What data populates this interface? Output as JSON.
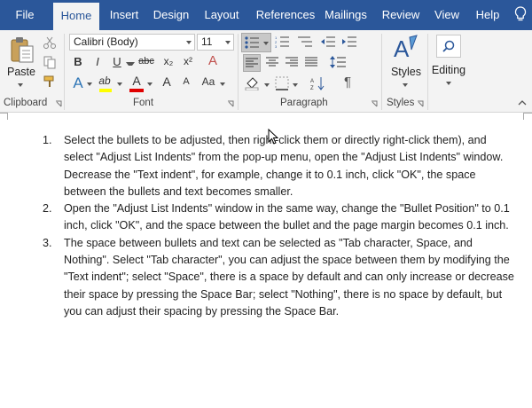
{
  "tabs": [
    {
      "label": "File",
      "active": false
    },
    {
      "label": "Home",
      "active": true
    },
    {
      "label": "Insert",
      "active": false
    },
    {
      "label": "Design",
      "active": false
    },
    {
      "label": "Layout",
      "active": false
    },
    {
      "label": "References",
      "active": false
    },
    {
      "label": "Mailings",
      "active": false
    },
    {
      "label": "Review",
      "active": false
    },
    {
      "label": "View",
      "active": false
    },
    {
      "label": "Help",
      "active": false
    }
  ],
  "ribbon": {
    "clipboard": {
      "paste_label": "Paste",
      "group_label": "Clipboard"
    },
    "font": {
      "font_name": "Calibri (Body)",
      "font_size": "11",
      "group_label": "Font",
      "bold": "B",
      "italic": "I",
      "underline": "U",
      "strike": "abc",
      "subscript": "x₂",
      "superscript": "x²",
      "clear": "A",
      "text_effects": "A",
      "highlight": "ab",
      "font_color": "A",
      "grow": "A",
      "shrink": "A",
      "case": "Aa"
    },
    "paragraph": {
      "group_label": "Paragraph",
      "show_marks": "¶"
    },
    "styles": {
      "label": "Styles",
      "group_label": "Styles"
    },
    "editing": {
      "label": "Editing"
    }
  },
  "colors": {
    "brand": "#2b579a",
    "highlight": "#ffff00",
    "font_color": "#e00000",
    "text_effect": "#2e75b6"
  },
  "document": {
    "items": [
      {
        "num": "1.",
        "text": "Select the bullets to be adjusted, then right-click them or directly right-click them), and select \"Adjust List Indents\" from the pop-up menu, open the \"Adjust List Indents\" window. Decrease the \"Text indent\", for example, change it to 0.1 inch, click \"OK\", the space between the bullets and text becomes smaller."
      },
      {
        "num": "2.",
        "text": "Open the \"Adjust List Indents\" window in the same way, change the \"Bullet Position\" to 0.1 inch, click \"OK\", and the space between the bullet and the page margin becomes 0.1 inch."
      },
      {
        "num": "3.",
        "text": "The space between bullets and text can be selected as \"Tab character, Space, and Nothing\". Select \"Tab character\", you can adjust the space between them by modifying the \"Text indent\"; select \"Space\", there is a space by default and can only increase or decrease their space by pressing the Space Bar; select \"Nothing\", there is no space by default, but you can adjust their spacing by pressing the Space Bar."
      }
    ]
  }
}
